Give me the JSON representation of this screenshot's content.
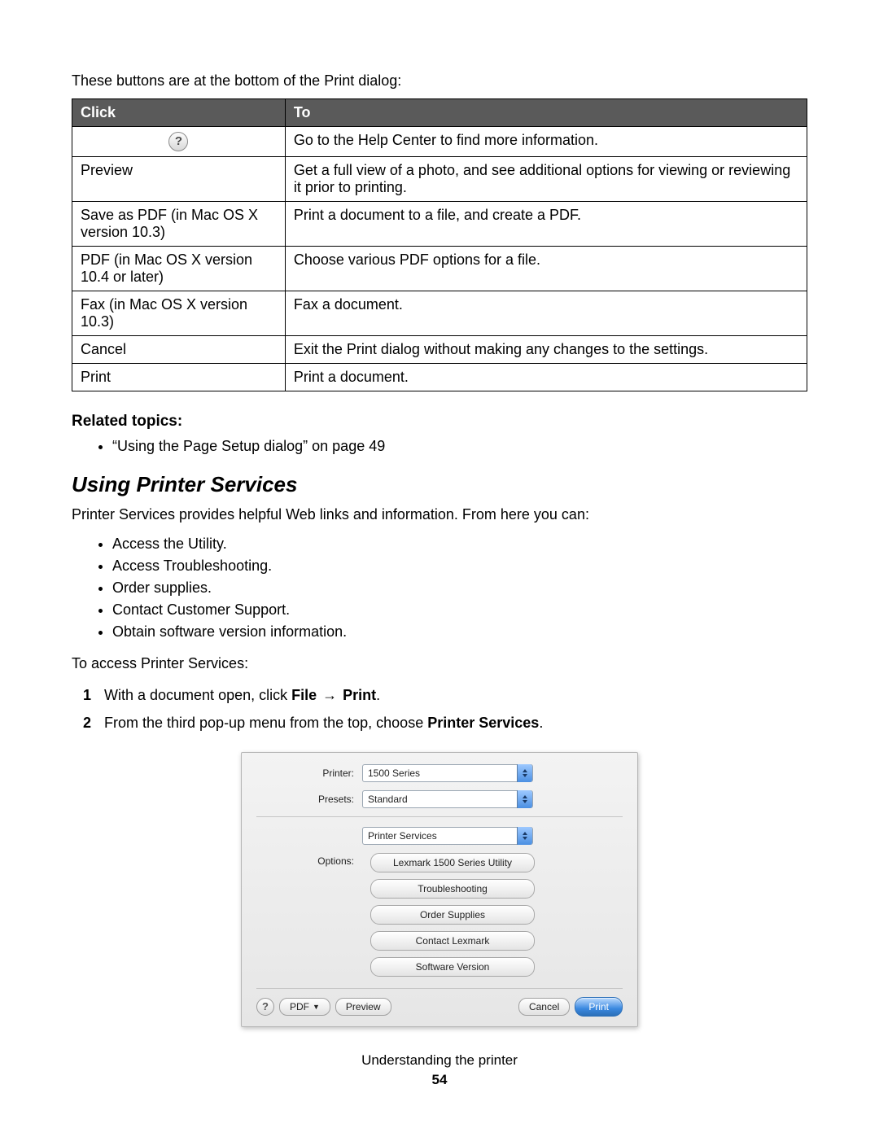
{
  "intro": "These buttons are at the bottom of the Print dialog:",
  "table": {
    "head": {
      "click": "Click",
      "to": "To"
    },
    "rows": [
      {
        "click_icon": "?",
        "click": "",
        "to": "Go to the Help Center to find more information."
      },
      {
        "click": "Preview",
        "to": "Get a full view of a photo, and see additional options for viewing or reviewing it prior to printing."
      },
      {
        "click": "Save as PDF (in Mac OS X version 10.3)",
        "to": "Print a document to a file, and create a PDF."
      },
      {
        "click": "PDF (in Mac OS X version 10.4 or later)",
        "to": "Choose various PDF options for a file."
      },
      {
        "click": "Fax (in Mac OS X version 10.3)",
        "to": "Fax a document."
      },
      {
        "click": "Cancel",
        "to": "Exit the Print dialog without making any changes to the settings."
      },
      {
        "click": "Print",
        "to": "Print a document."
      }
    ]
  },
  "related": {
    "heading": "Related topics:",
    "items": [
      "“Using the Page Setup dialog” on page 49"
    ]
  },
  "section": {
    "heading": "Using Printer Services",
    "lead": "Printer Services provides helpful Web links and information. From here you can:",
    "bullets": [
      "Access the Utility.",
      "Access Troubleshooting.",
      "Order supplies.",
      "Contact Customer Support.",
      "Obtain software version information."
    ],
    "access_lead": "To access Printer Services:",
    "steps": {
      "s1_pre": "With a document open, click ",
      "s1_b1": "File",
      "s1_arrow": "→",
      "s1_b2": "Print",
      "s1_post": ".",
      "s2_pre": "From the third pop-up menu from the top, choose ",
      "s2_b": "Printer Services",
      "s2_post": "."
    }
  },
  "dialog": {
    "labels": {
      "printer": "Printer:",
      "presets": "Presets:",
      "options": "Options:"
    },
    "printer_value": "1500 Series",
    "presets_value": "Standard",
    "third_value": "Printer Services",
    "option_buttons": [
      "Lexmark 1500 Series Utility",
      "Troubleshooting",
      "Order Supplies",
      "Contact Lexmark",
      "Software Version"
    ],
    "bottom": {
      "help": "?",
      "pdf": "PDF",
      "preview": "Preview",
      "cancel": "Cancel",
      "print": "Print"
    }
  },
  "footer": {
    "chapter": "Understanding the printer",
    "page": "54"
  }
}
